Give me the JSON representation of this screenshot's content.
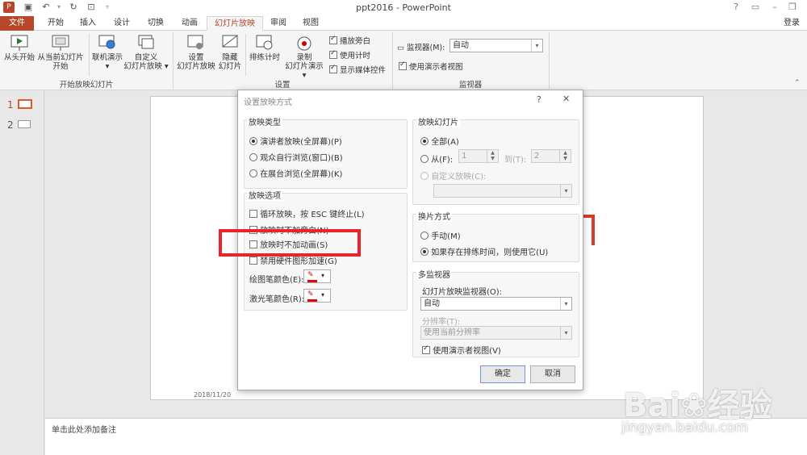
{
  "titlebar": {
    "title": "ppt2016 - PowerPoint",
    "help": "?",
    "login": "登录"
  },
  "tabs": [
    "文件",
    "开始",
    "插入",
    "设计",
    "切换",
    "动画",
    "幻灯片放映",
    "审阅",
    "视图"
  ],
  "ribbon": {
    "from_start": "从头开始",
    "from_current_1": "从当前幻灯片",
    "from_current_2": "开始",
    "online_1": "联机演示",
    "custom_1": "自定义",
    "custom_2": "幻灯片放映",
    "group_start": "开始放映幻灯片",
    "setup_1": "设置",
    "setup_2": "幻灯片放映",
    "hide_1": "隐藏",
    "hide_2": "幻灯片",
    "rehearse": "排练计时",
    "record_1": "录制",
    "record_2": "幻灯片演示",
    "cb_narration": "播放旁白",
    "cb_timing": "使用计时",
    "cb_media": "显示媒体控件",
    "group_setup": "设置",
    "monitor_label": "监视器(M):",
    "monitor_value": "自动",
    "presenter_view": "使用演示者视图",
    "group_monitor": "监视器"
  },
  "slides": [
    "1",
    "2"
  ],
  "slide_date": "2018/11/20",
  "notes_placeholder": "单击此处添加备注",
  "dialog": {
    "title": "设置放映方式",
    "help": "?",
    "close": "✕",
    "show_type": {
      "label": "放映类型",
      "options": [
        "演讲者放映(全屏幕)(P)",
        "观众自行浏览(窗口)(B)",
        "在展台浏览(全屏幕)(K)"
      ]
    },
    "show_options": {
      "label": "放映选项",
      "loop": "循环放映，按 ESC 键终止(L)",
      "no_narration": "放映时不加旁白(N)",
      "no_animation": "放映时不加动画(S)",
      "no_hw": "禁用硬件图形加速(G)",
      "pen_color": "绘图笔颜色(E):",
      "laser_color": "激光笔颜色(R):"
    },
    "show_slides": {
      "label": "放映幻灯片",
      "all": "全部(A)",
      "from": "从(F):",
      "from_value": "1",
      "to": "到(T):",
      "to_value": "2",
      "custom": "自定义放映(C):"
    },
    "advance": {
      "label": "换片方式",
      "manual": "手动(M)",
      "timing": "如果存在排练时间，则使用它(U)"
    },
    "multi_monitor": {
      "label": "多监视器",
      "monitor_label": "幻灯片放映监视器(O):",
      "monitor_value": "自动",
      "resolution_label": "分辨率(T):",
      "resolution_value": "使用当前分辨率",
      "presenter_view": "使用演示者视图(V)"
    },
    "ok": "确定",
    "cancel": "取消"
  },
  "watermark": {
    "brand": "Bai",
    "brand2": "经验",
    "url": "jingyan.baidu.com"
  },
  "colors": {
    "accent": "#b7472a",
    "highlight": "#e8262a"
  }
}
